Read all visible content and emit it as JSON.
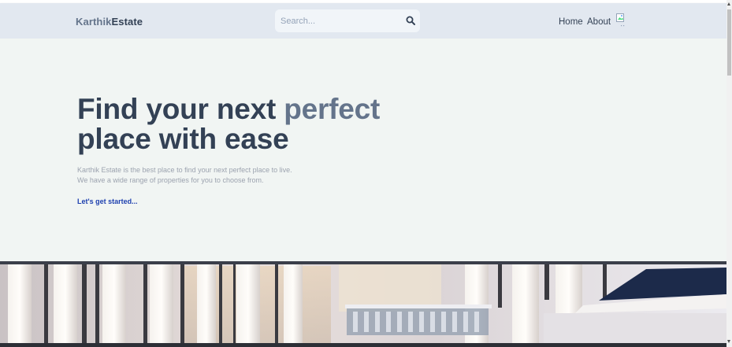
{
  "header": {
    "logo_part1": "Karthik",
    "logo_part2": "Estate",
    "search": {
      "placeholder": "Search...",
      "value": ""
    },
    "nav": {
      "home": "Home",
      "about": "About"
    },
    "icons": {
      "search": "search-icon",
      "profile": "avatar-image"
    }
  },
  "hero": {
    "title_part1": "Find your next ",
    "title_accent": "perfect",
    "title_part2": "place with ease",
    "description_line1": "Karthik Estate is the best place to find your next perfect place to live.",
    "description_line2": "We have a wide range of properties for you to choose from.",
    "cta": "Let's get started..."
  },
  "colors": {
    "header_bg": "#e2e8f0",
    "hero_bg": "#f1f5f3",
    "title": "#334155",
    "title_accent": "#64748b",
    "link": "#1e40af"
  }
}
